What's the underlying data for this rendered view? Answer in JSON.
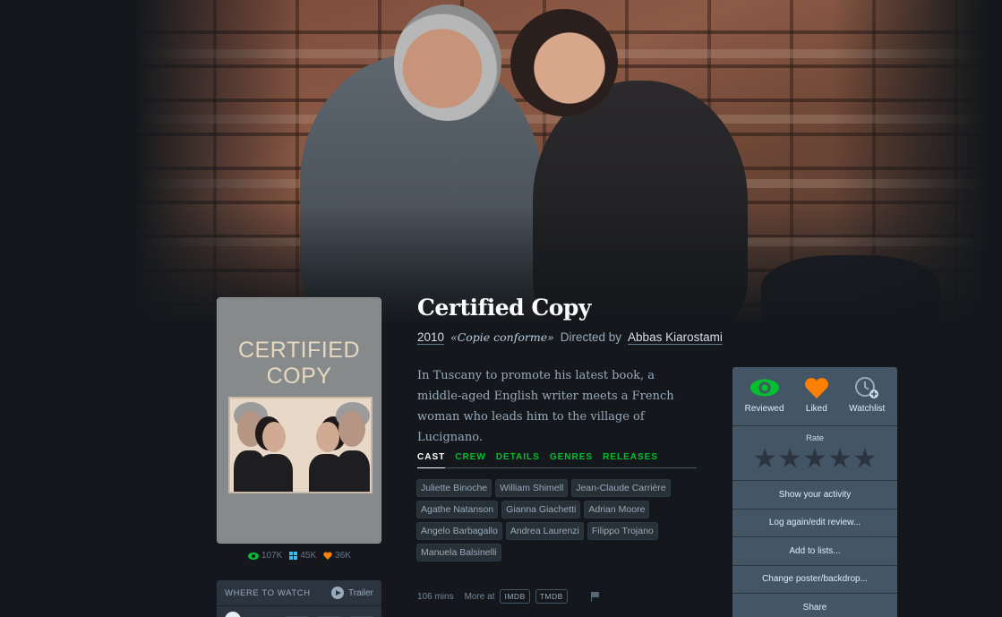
{
  "film": {
    "title": "Certified Copy",
    "year": "2010",
    "original_title": "«Copie conforme»",
    "directed_by": "Directed by",
    "director": "Abbas Kiarostami",
    "synopsis": "In Tuscany to promote his latest book, a middle-aged English writer meets a French woman who leads him to the village of Lucignano."
  },
  "poster": {
    "title_text": "CERTIFIED\nCOPY",
    "stats": {
      "watched": "107K",
      "lists": "45K",
      "likes": "36K"
    }
  },
  "where_to_watch": {
    "label": "WHERE TO WATCH",
    "trailer": "Trailer"
  },
  "tabs": [
    "CAST",
    "CREW",
    "DETAILS",
    "GENRES",
    "RELEASES"
  ],
  "cast": [
    "Juliette Binoche",
    "William Shimell",
    "Jean-Claude Carrière",
    "Agathe Natanson",
    "Gianna Giachetti",
    "Adrian Moore",
    "Angelo Barbagallo",
    "Andrea Laurenzi",
    "Filippo Trojano",
    "Manuela Balsinelli"
  ],
  "footer": {
    "runtime": "106 mins",
    "more_at": "More at",
    "imdb": "IMDB",
    "tmdb": "TMDB"
  },
  "actions": {
    "reviewed": "Reviewed",
    "liked": "Liked",
    "watchlist": "Watchlist",
    "rate": "Rate",
    "show_activity": "Show your activity",
    "log_again": "Log again/edit review...",
    "add_to_lists": "Add to lists...",
    "change_poster": "Change poster/backdrop...",
    "share": "Share"
  },
  "colors": {
    "green": "#00c030",
    "orange": "#ff8000",
    "blue": "#40bcf4",
    "background": "#14181c"
  }
}
